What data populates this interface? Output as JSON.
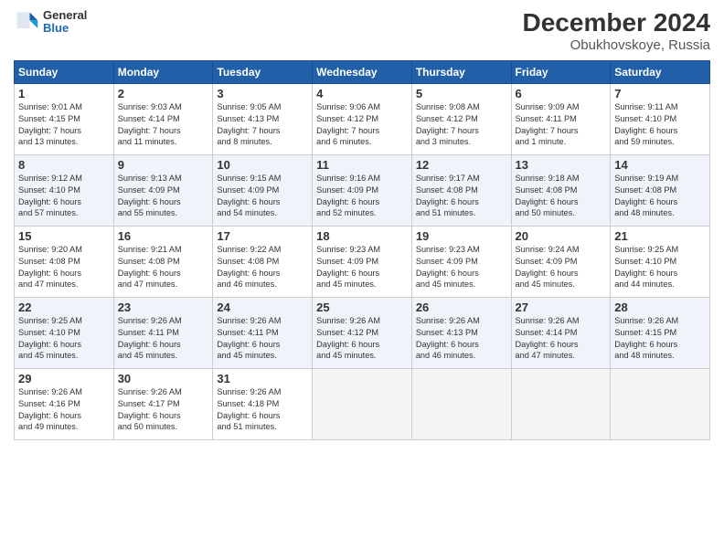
{
  "header": {
    "logo_line1": "General",
    "logo_line2": "Blue",
    "title": "December 2024",
    "subtitle": "Obukhovskoye, Russia"
  },
  "days_of_week": [
    "Sunday",
    "Monday",
    "Tuesday",
    "Wednesday",
    "Thursday",
    "Friday",
    "Saturday"
  ],
  "weeks": [
    [
      {
        "day": "1",
        "info": "Sunrise: 9:01 AM\nSunset: 4:15 PM\nDaylight: 7 hours\nand 13 minutes."
      },
      {
        "day": "2",
        "info": "Sunrise: 9:03 AM\nSunset: 4:14 PM\nDaylight: 7 hours\nand 11 minutes."
      },
      {
        "day": "3",
        "info": "Sunrise: 9:05 AM\nSunset: 4:13 PM\nDaylight: 7 hours\nand 8 minutes."
      },
      {
        "day": "4",
        "info": "Sunrise: 9:06 AM\nSunset: 4:12 PM\nDaylight: 7 hours\nand 6 minutes."
      },
      {
        "day": "5",
        "info": "Sunrise: 9:08 AM\nSunset: 4:12 PM\nDaylight: 7 hours\nand 3 minutes."
      },
      {
        "day": "6",
        "info": "Sunrise: 9:09 AM\nSunset: 4:11 PM\nDaylight: 7 hours\nand 1 minute."
      },
      {
        "day": "7",
        "info": "Sunrise: 9:11 AM\nSunset: 4:10 PM\nDaylight: 6 hours\nand 59 minutes."
      }
    ],
    [
      {
        "day": "8",
        "info": "Sunrise: 9:12 AM\nSunset: 4:10 PM\nDaylight: 6 hours\nand 57 minutes."
      },
      {
        "day": "9",
        "info": "Sunrise: 9:13 AM\nSunset: 4:09 PM\nDaylight: 6 hours\nand 55 minutes."
      },
      {
        "day": "10",
        "info": "Sunrise: 9:15 AM\nSunset: 4:09 PM\nDaylight: 6 hours\nand 54 minutes."
      },
      {
        "day": "11",
        "info": "Sunrise: 9:16 AM\nSunset: 4:09 PM\nDaylight: 6 hours\nand 52 minutes."
      },
      {
        "day": "12",
        "info": "Sunrise: 9:17 AM\nSunset: 4:08 PM\nDaylight: 6 hours\nand 51 minutes."
      },
      {
        "day": "13",
        "info": "Sunrise: 9:18 AM\nSunset: 4:08 PM\nDaylight: 6 hours\nand 50 minutes."
      },
      {
        "day": "14",
        "info": "Sunrise: 9:19 AM\nSunset: 4:08 PM\nDaylight: 6 hours\nand 48 minutes."
      }
    ],
    [
      {
        "day": "15",
        "info": "Sunrise: 9:20 AM\nSunset: 4:08 PM\nDaylight: 6 hours\nand 47 minutes."
      },
      {
        "day": "16",
        "info": "Sunrise: 9:21 AM\nSunset: 4:08 PM\nDaylight: 6 hours\nand 47 minutes."
      },
      {
        "day": "17",
        "info": "Sunrise: 9:22 AM\nSunset: 4:08 PM\nDaylight: 6 hours\nand 46 minutes."
      },
      {
        "day": "18",
        "info": "Sunrise: 9:23 AM\nSunset: 4:09 PM\nDaylight: 6 hours\nand 45 minutes."
      },
      {
        "day": "19",
        "info": "Sunrise: 9:23 AM\nSunset: 4:09 PM\nDaylight: 6 hours\nand 45 minutes."
      },
      {
        "day": "20",
        "info": "Sunrise: 9:24 AM\nSunset: 4:09 PM\nDaylight: 6 hours\nand 45 minutes."
      },
      {
        "day": "21",
        "info": "Sunrise: 9:25 AM\nSunset: 4:10 PM\nDaylight: 6 hours\nand 44 minutes."
      }
    ],
    [
      {
        "day": "22",
        "info": "Sunrise: 9:25 AM\nSunset: 4:10 PM\nDaylight: 6 hours\nand 45 minutes."
      },
      {
        "day": "23",
        "info": "Sunrise: 9:26 AM\nSunset: 4:11 PM\nDaylight: 6 hours\nand 45 minutes."
      },
      {
        "day": "24",
        "info": "Sunrise: 9:26 AM\nSunset: 4:11 PM\nDaylight: 6 hours\nand 45 minutes."
      },
      {
        "day": "25",
        "info": "Sunrise: 9:26 AM\nSunset: 4:12 PM\nDaylight: 6 hours\nand 45 minutes."
      },
      {
        "day": "26",
        "info": "Sunrise: 9:26 AM\nSunset: 4:13 PM\nDaylight: 6 hours\nand 46 minutes."
      },
      {
        "day": "27",
        "info": "Sunrise: 9:26 AM\nSunset: 4:14 PM\nDaylight: 6 hours\nand 47 minutes."
      },
      {
        "day": "28",
        "info": "Sunrise: 9:26 AM\nSunset: 4:15 PM\nDaylight: 6 hours\nand 48 minutes."
      }
    ],
    [
      {
        "day": "29",
        "info": "Sunrise: 9:26 AM\nSunset: 4:16 PM\nDaylight: 6 hours\nand 49 minutes."
      },
      {
        "day": "30",
        "info": "Sunrise: 9:26 AM\nSunset: 4:17 PM\nDaylight: 6 hours\nand 50 minutes."
      },
      {
        "day": "31",
        "info": "Sunrise: 9:26 AM\nSunset: 4:18 PM\nDaylight: 6 hours\nand 51 minutes."
      },
      {
        "day": "",
        "info": ""
      },
      {
        "day": "",
        "info": ""
      },
      {
        "day": "",
        "info": ""
      },
      {
        "day": "",
        "info": ""
      }
    ]
  ]
}
